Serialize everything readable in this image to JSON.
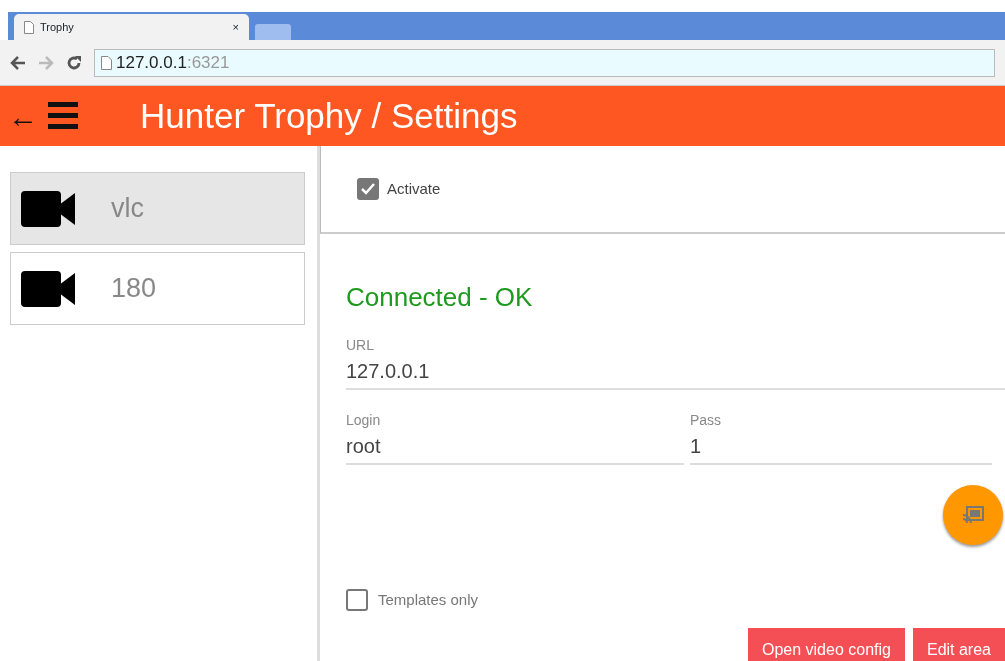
{
  "browser": {
    "tab_title": "Trophy",
    "close": "×",
    "url_host": "127.0.0.1",
    "url_port": ":6321"
  },
  "header": {
    "back": "←",
    "title": "Hunter Trophy / Settings"
  },
  "sidebar": {
    "items": [
      {
        "label": "vlc",
        "selected": true
      },
      {
        "label": "180",
        "selected": false
      }
    ]
  },
  "activate": {
    "label": "Activate",
    "checked": true
  },
  "status": "Connected - OK",
  "fields": [
    {
      "label": "URL",
      "value": "127.0.0.1"
    },
    {
      "label": "Login",
      "value": "root"
    },
    {
      "label": "Pass",
      "value": "1"
    }
  ],
  "templates_only": {
    "label": "Templates only",
    "checked": false
  },
  "buttons": [
    "Open video config",
    "Edit area"
  ]
}
